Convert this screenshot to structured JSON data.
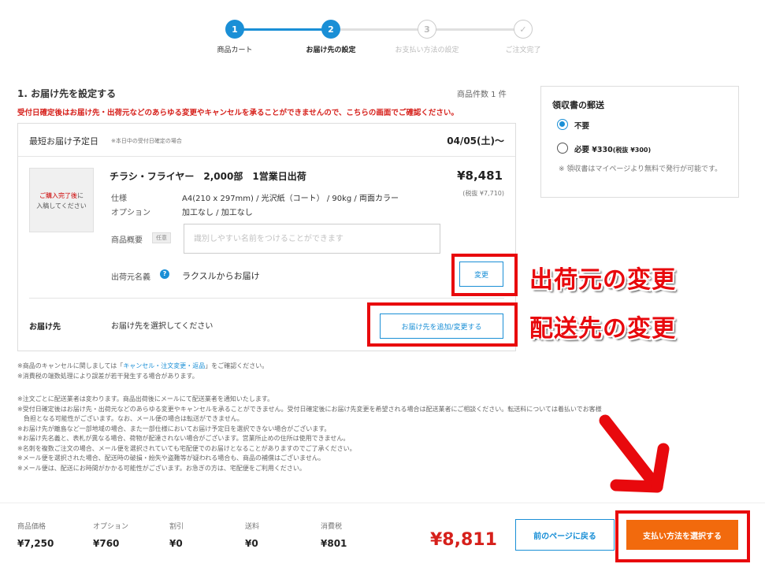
{
  "stepper": {
    "steps": [
      {
        "num": "1",
        "label": "商品カート"
      },
      {
        "num": "2",
        "label": "お届け先の設定"
      },
      {
        "num": "3",
        "label": "お支払い方法の設定"
      },
      {
        "num": "✓",
        "label": "ご注文完了"
      }
    ]
  },
  "section": {
    "title": "1. お届け先を設定する",
    "item_count": "商品件数 1 件",
    "warning": "受付日確定後はお届け先・出荷元などのあらゆる変更やキャンセルを承ることができませんので、こちらの画面でご確認ください。"
  },
  "delivery": {
    "label": "最短お届け予定日",
    "note": "※本日中の受付日確定の場合",
    "date": "04/05(土)〜"
  },
  "product": {
    "thumb_line1": "ご購入完了後",
    "thumb_line1b": "に",
    "thumb_line2": "入稿してください",
    "name": "チラシ・フライヤー　2,000部　1営業日出荷",
    "price": "¥8,481",
    "tax_excluded": "(税抜 ¥7,710)",
    "spec_label": "仕様",
    "spec_value": "A4(210 x 297mm) / 光沢紙（コート） / 90kg / 両面カラー",
    "option_label": "オプション",
    "option_value": "加工なし / 加工なし",
    "memo_label": "商品概要",
    "memo_tag": "任意",
    "memo_placeholder": "識別しやすい名前をつけることができます",
    "origin_label": "出荷元名義",
    "origin_value": "ラクスルからお届け",
    "change_button": "変更"
  },
  "destination": {
    "label": "お届け先",
    "value": "お届け先を選択してください",
    "button": "お届け先を追加/変更する"
  },
  "annotations": {
    "origin_change": "出荷元の変更",
    "dest_change": "配送先の変更",
    "highlight_color": "#e8090d"
  },
  "receipt": {
    "title": "領収書の郵送",
    "option1": "不要",
    "option2": "必要 ¥330",
    "option2_small": "(税抜 ¥300)",
    "note": "※ 領収書はマイページより無料で発行が可能です。"
  },
  "notes1": {
    "line1_pre": "※商品のキャンセルに関しましては「",
    "line1_link": "キャンセル・注文変更・返品",
    "line1_post": "」をご確認ください。",
    "line2": "※消費税の端数処理により誤差が若干発生する場合があります。"
  },
  "notes2": [
    "※注文ごとに配送業者は変わります。商品出荷後にメールにて配送業者を通知いたします。",
    "※受付日確定後はお届け先・出荷元などのあらゆる変更やキャンセルを承ることができません。受付日確定後にお届け先変更を希望される場合は配送業者にご相談ください。転送料については着払いでお客様",
    "　負担となる可能性がございます。なお、メール便の場合は転送ができません。",
    "※お届け先が離島など一部地域の場合、また一部仕様においてお届け予定日を選択できない場合がございます。",
    "※お届け先名義と、表札が異なる場合、荷物が配達されない場合がございます。営業所止めの住所は使用できません。",
    "※名刺を複数ご注文の場合、メール便を選択されていても宅配便でのお届けとなることがありますのでご了承ください。",
    "※メール便を選択された場合、配送時の破損・紛失や盗難等が疑われる場合も、商品の補償はございません。",
    "※メール便は、配送にお時間がかかる可能性がございます。お急ぎの方は、宅配便をご利用ください。"
  ],
  "footer": {
    "items": [
      {
        "label": "商品価格",
        "value": "¥7,250"
      },
      {
        "label": "オプション",
        "value": "¥760"
      },
      {
        "label": "割引",
        "value": "¥0"
      },
      {
        "label": "送料",
        "value": "¥0"
      },
      {
        "label": "消費税",
        "value": "¥801"
      }
    ],
    "total": "¥8,811",
    "back_button": "前のページに戻る",
    "pay_button": "支払い方法を選択する"
  },
  "colors": {
    "accent": "#1a8fd6",
    "warning": "#d6201b",
    "pay_button": "#f26a0d"
  }
}
